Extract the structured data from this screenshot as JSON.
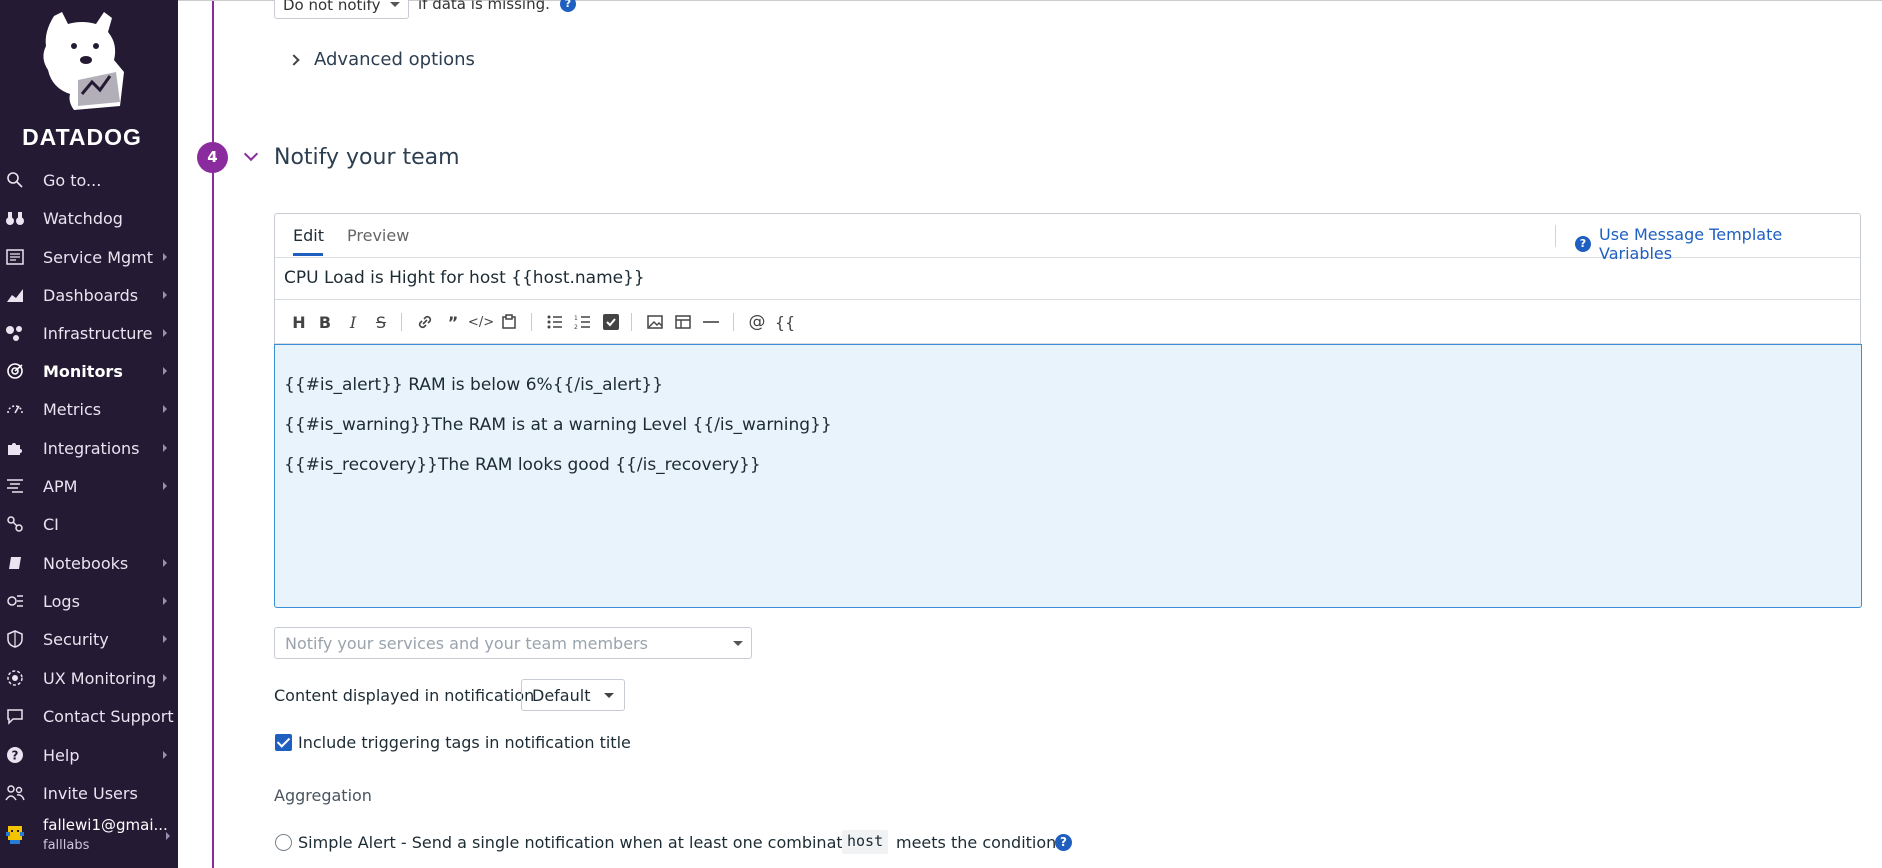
{
  "sidebar": {
    "brand": "DATADOG",
    "items": [
      {
        "label": "Go to...",
        "icon": "search-icon",
        "arrow": false
      },
      {
        "label": "Watchdog",
        "icon": "binoculars-icon",
        "arrow": false
      },
      {
        "label": "Service Mgmt",
        "icon": "service-icon",
        "arrow": true
      },
      {
        "label": "Dashboards",
        "icon": "dashboard-icon",
        "arrow": true
      },
      {
        "label": "Infrastructure",
        "icon": "infrastructure-icon",
        "arrow": true
      },
      {
        "label": "Monitors",
        "icon": "monitor-icon",
        "arrow": true,
        "active": true
      },
      {
        "label": "Metrics",
        "icon": "metrics-icon",
        "arrow": true
      },
      {
        "label": "Integrations",
        "icon": "puzzle-icon",
        "arrow": true
      },
      {
        "label": "APM",
        "icon": "apm-icon",
        "arrow": true
      },
      {
        "label": "CI",
        "icon": "ci-icon",
        "arrow": false
      },
      {
        "label": "Notebooks",
        "icon": "notebook-icon",
        "arrow": true
      },
      {
        "label": "Logs",
        "icon": "logs-icon",
        "arrow": true
      },
      {
        "label": "Security",
        "icon": "shield-icon",
        "arrow": true
      },
      {
        "label": "UX Monitoring",
        "icon": "ux-icon",
        "arrow": true
      },
      {
        "label": "Contact Support",
        "icon": "chat-icon",
        "arrow": false
      },
      {
        "label": "Help",
        "icon": "help-icon",
        "arrow": true
      },
      {
        "label": "Invite Users",
        "icon": "users-icon",
        "arrow": false
      }
    ],
    "user": {
      "email": "fallewi1@gmai...",
      "org": "falllabs"
    }
  },
  "top": {
    "notify_dropdown": "Do not notify",
    "if_missing_text": "if data is missing."
  },
  "advanced_label": "Advanced options",
  "step": {
    "number": "4",
    "title": "Notify your team"
  },
  "editor": {
    "tabs": [
      "Edit",
      "Preview"
    ],
    "template_link": "Use Message Template Variables",
    "title_value": "CPU Load is Hight for host {{host.name}}",
    "body_lines": [
      "{{#is_alert}} RAM is below 6%{{/is_alert}}",
      "{{#is_warning}}The RAM is at a warning Level {{/is_warning}}",
      "{{#is_recovery}}The RAM looks good {{/is_recovery}}"
    ],
    "toolbar": {
      "mention_glyph": "@",
      "variable_glyph": "{{"
    }
  },
  "notify_placeholder": "Notify your services and your team members",
  "content_label": "Content displayed in notification",
  "content_value": "Default",
  "include_tags_label": "Include triggering tags in notification title",
  "aggregation_label": "Aggregation",
  "simple_alert": {
    "prefix": "Simple Alert - Send a single notification when at least one combination of",
    "code": "host",
    "suffix": "meets the condition."
  },
  "colors": {
    "accent": "#8b2c9e",
    "link": "#1f5fc0",
    "sidebar": "#241a33"
  }
}
